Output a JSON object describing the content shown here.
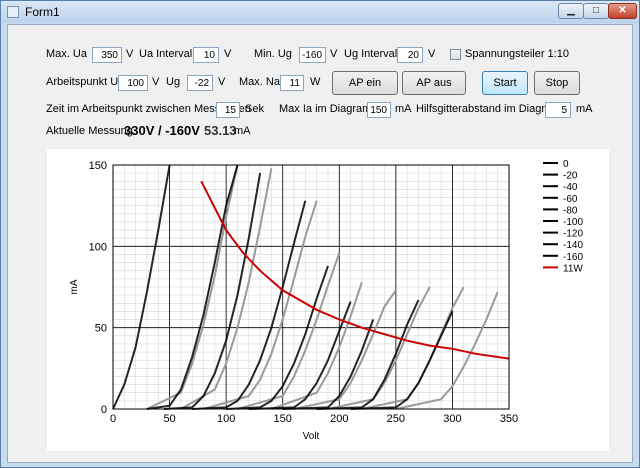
{
  "window": {
    "title": "Form1",
    "min_glyph": "▁",
    "max_glyph": "□",
    "close_glyph": "✕"
  },
  "row1": {
    "max_ua_label": "Max. Ua",
    "max_ua_value": "350",
    "max_ua_unit": "V",
    "ua_interval_label": "Ua Intervall",
    "ua_interval_value": "10",
    "ua_interval_unit": "V",
    "min_ug_label": "Min. Ug",
    "min_ug_value": "-160",
    "min_ug_unit": "V",
    "ug_interval_label": "Ug Intervall",
    "ug_interval_value": "20",
    "ug_interval_unit": "V",
    "divider_label": "Spannungsteiler 1:10",
    "divider_checked": false
  },
  "row2": {
    "ap_ua_label": "Arbeitspunkt Ua",
    "ap_ua_value": "100",
    "ap_ua_unit": "V",
    "ug_label": "Ug",
    "ug_value": "-22",
    "ug_unit": "V",
    "max_na_label": "Max. Na",
    "max_na_value": "11",
    "max_na_unit": "W",
    "ap_on_label": "AP ein",
    "ap_off_label": "AP aus",
    "start_label": "Start",
    "stop_label": "Stop"
  },
  "row3": {
    "time_label": "Zeit im Arbeitspunkt zwischen Messungen",
    "time_value": "15",
    "time_unit": "Sek",
    "max_ia_label": "Max Ia im Diagramm",
    "max_ia_value": "150",
    "max_ia_unit": "mA",
    "grid_distance_label": "Hilfsgitterabstand im Diagramm",
    "grid_distance_value": "5",
    "grid_distance_unit": "mA"
  },
  "row4": {
    "current_label": "Aktuelle Messung",
    "voltage_reading": "330V / -160V",
    "current_reading": "53.13",
    "current_unit": "mA"
  },
  "chart_data": {
    "type": "line",
    "xlabel": "Volt",
    "ylabel": "mA",
    "xlim": [
      0,
      350
    ],
    "ylim": [
      0,
      150
    ],
    "x_ticks": [
      "0",
      "50",
      "100",
      "150",
      "200",
      "250",
      "300",
      "350"
    ],
    "y_ticks": [
      "0",
      "50",
      "100",
      "150"
    ],
    "major_grid": true,
    "minor_grid_mA": 5,
    "minor_grid_V": 10,
    "legend_position": "right",
    "series": [
      {
        "name": "0",
        "color": "#000000",
        "x": [
          0,
          10,
          20,
          30,
          40,
          50
        ],
        "y": [
          0,
          15,
          38,
          72,
          110,
          150
        ]
      },
      {
        "name": "-20",
        "color": "#000000",
        "x": [
          30,
          50,
          60,
          70,
          80,
          90,
          100,
          110
        ],
        "y": [
          0,
          2,
          12,
          32,
          58,
          90,
          125,
          150
        ]
      },
      {
        "name": "-40",
        "color": "#000000",
        "x": [
          45,
          70,
          80,
          90,
          100,
          110,
          120,
          130
        ],
        "y": [
          0,
          1,
          8,
          22,
          42,
          70,
          105,
          145
        ]
      },
      {
        "name": "-60",
        "color": "#000000",
        "x": [
          70,
          100,
          110,
          120,
          130,
          140,
          150,
          160,
          170
        ],
        "y": [
          0,
          1,
          5,
          15,
          30,
          50,
          75,
          102,
          128
        ]
      },
      {
        "name": "-80",
        "color": "#000000",
        "x": [
          100,
          130,
          140,
          150,
          160,
          170,
          180,
          190
        ],
        "y": [
          0,
          1,
          5,
          14,
          28,
          46,
          68,
          88
        ]
      },
      {
        "name": "-100",
        "color": "#000000",
        "x": [
          120,
          160,
          170,
          180,
          190,
          200,
          210
        ],
        "y": [
          0,
          1,
          6,
          16,
          30,
          48,
          66
        ]
      },
      {
        "name": "-120",
        "color": "#000000",
        "x": [
          150,
          190,
          200,
          210,
          220,
          230
        ],
        "y": [
          0,
          1,
          8,
          20,
          36,
          55
        ]
      },
      {
        "name": "-140",
        "color": "#000000",
        "x": [
          180,
          220,
          230,
          240,
          250,
          260,
          270
        ],
        "y": [
          0,
          1,
          6,
          18,
          34,
          52,
          67
        ]
      },
      {
        "name": "-160",
        "color": "#000000",
        "x": [
          210,
          250,
          260,
          270,
          280,
          290,
          300
        ],
        "y": [
          0,
          1,
          6,
          16,
          30,
          45,
          60
        ]
      },
      {
        "name": "11W",
        "color": "#cc0000",
        "x": [
          78,
          100,
          115,
          130,
          150,
          170,
          180,
          200,
          220,
          240,
          260,
          280,
          300,
          320,
          350
        ],
        "y": [
          140,
          110,
          96,
          85,
          73,
          65,
          61,
          55,
          50,
          46,
          42,
          39,
          37,
          34,
          31
        ]
      }
    ],
    "secondary_series_color": "#9a9a9a",
    "secondary_series": [
      {
        "x": [
          30,
          60,
          70,
          80,
          90,
          100,
          110
        ],
        "y": [
          0,
          10,
          28,
          52,
          82,
          118,
          150
        ]
      },
      {
        "x": [
          60,
          90,
          100,
          110,
          120,
          130,
          140
        ],
        "y": [
          0,
          12,
          28,
          50,
          78,
          112,
          148
        ]
      },
      {
        "x": [
          80,
          120,
          130,
          140,
          150,
          160,
          170,
          180
        ],
        "y": [
          0,
          8,
          18,
          34,
          55,
          80,
          106,
          128
        ]
      },
      {
        "x": [
          110,
          150,
          160,
          170,
          180,
          190,
          200
        ],
        "y": [
          0,
          8,
          20,
          36,
          55,
          76,
          96
        ]
      },
      {
        "x": [
          140,
          180,
          190,
          200,
          210,
          220
        ],
        "y": [
          0,
          10,
          22,
          38,
          57,
          78
        ]
      },
      {
        "x": [
          160,
          200,
          210,
          220,
          230,
          240,
          250
        ],
        "y": [
          0,
          6,
          16,
          30,
          46,
          63,
          73
        ]
      },
      {
        "x": [
          190,
          230,
          240,
          250,
          260,
          270,
          280
        ],
        "y": [
          0,
          6,
          16,
          30,
          46,
          62,
          75
        ]
      },
      {
        "x": [
          220,
          260,
          270,
          280,
          290,
          300,
          310
        ],
        "y": [
          0,
          6,
          16,
          30,
          46,
          62,
          75
        ]
      },
      {
        "x": [
          250,
          290,
          300,
          310,
          320,
          330,
          340
        ],
        "y": [
          0,
          6,
          14,
          26,
          40,
          55,
          72
        ]
      }
    ]
  }
}
